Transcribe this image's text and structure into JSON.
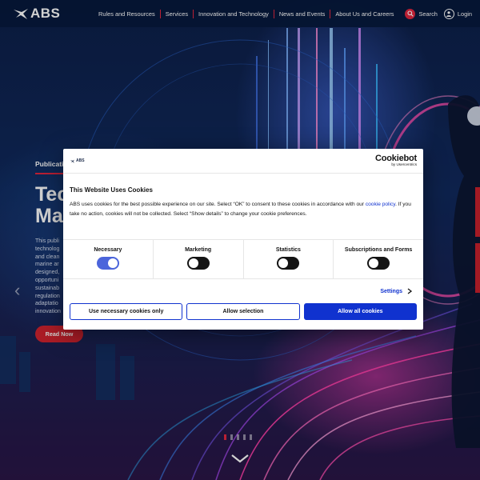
{
  "header": {
    "logo_text": "ABS",
    "nav": [
      "Rules and Resources",
      "Services",
      "Innovation and Technology",
      "News and Events",
      "About Us and Careers"
    ],
    "search_label": "Search",
    "login_label": "Login"
  },
  "hero": {
    "category": "Publicati",
    "title_line1": "Tec",
    "title_line2": "Ma",
    "description_lines": [
      "This publi",
      "technolog",
      "and clean",
      "marine ar",
      "designed,",
      "opportuni",
      "sustainab",
      "regulation",
      "adaptatio",
      "innovation"
    ],
    "read_button": "Read Now"
  },
  "cookie_dialog": {
    "small_logo": "ABS",
    "brand_main": "Cookiebot",
    "brand_sub": "by Usercentrics",
    "title": "This Website Uses Cookies",
    "text_before_link": "ABS uses cookies for the best possible experience on our site. Select “OK” to consent to these cookies in accordance with our ",
    "link_text": "cookie policy",
    "text_after_link": ". If you take no action, cookies will not be collected. Select “Show details” to change your cookie preferences.",
    "categories": [
      {
        "label": "Necessary",
        "on": true
      },
      {
        "label": "Marketing",
        "on": false
      },
      {
        "label": "Statistics",
        "on": false
      },
      {
        "label": "Subscriptions and Forms",
        "on": false
      }
    ],
    "settings_label": "Settings",
    "buttons": {
      "necessary_only": "Use necessary cookies only",
      "allow_selection": "Allow selection",
      "allow_all": "Allow all cookies"
    }
  },
  "colors": {
    "accent_red": "#e2263f",
    "cookiebot_blue": "#1032cf",
    "header_bg": "#06193c"
  }
}
